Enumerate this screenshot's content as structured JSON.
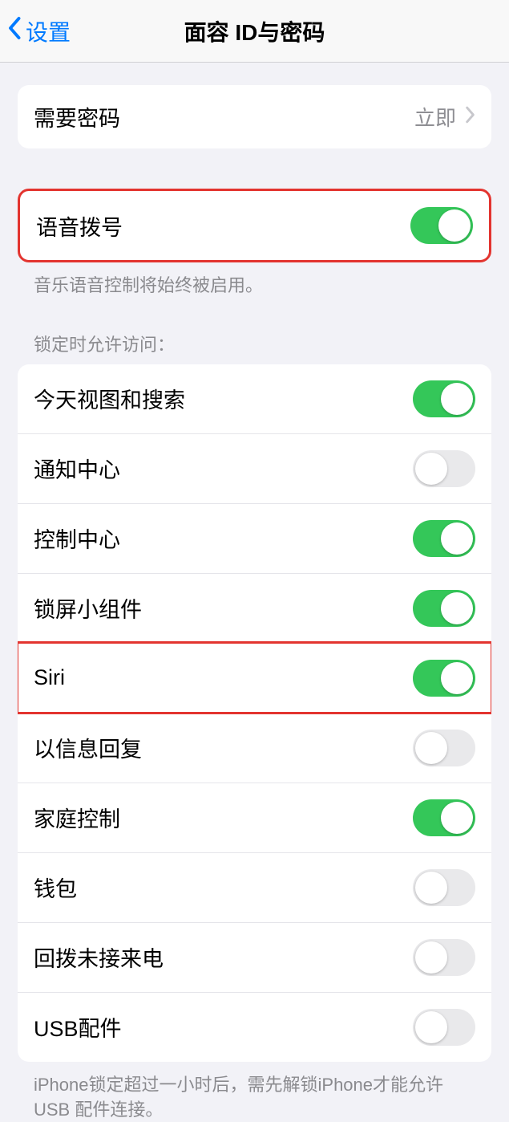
{
  "nav": {
    "back": "设置",
    "title": "面容 ID与密码"
  },
  "requirePasscode": {
    "label": "需要密码",
    "value": "立即"
  },
  "voiceDial": {
    "label": "语音拨号",
    "on": true,
    "footer": "音乐语音控制将始终被启用。"
  },
  "lockedAccess": {
    "header": "锁定时允许访问：",
    "items": [
      {
        "label": "今天视图和搜索",
        "on": true
      },
      {
        "label": "通知中心",
        "on": false
      },
      {
        "label": "控制中心",
        "on": true
      },
      {
        "label": "锁屏小组件",
        "on": true
      },
      {
        "label": "Siri",
        "on": true
      },
      {
        "label": "以信息回复",
        "on": false
      },
      {
        "label": "家庭控制",
        "on": true
      },
      {
        "label": "钱包",
        "on": false
      },
      {
        "label": "回拨未接来电",
        "on": false
      },
      {
        "label": "USB配件",
        "on": false
      }
    ],
    "footer": "iPhone锁定超过一小时后，需先解锁iPhone才能允许USB 配件连接。"
  }
}
